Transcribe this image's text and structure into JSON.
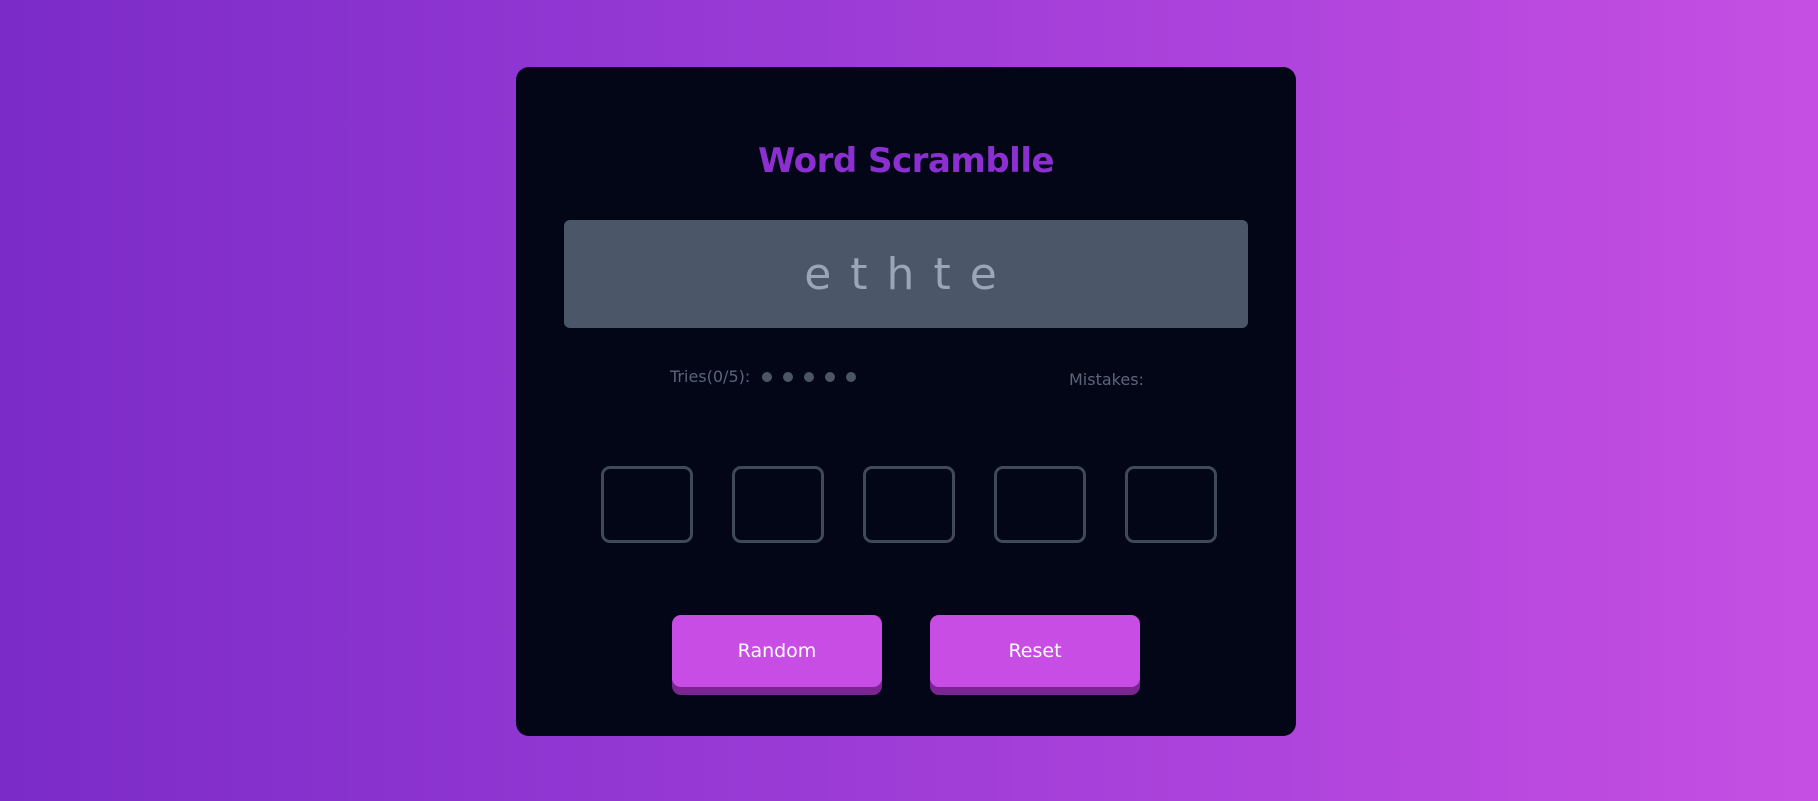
{
  "game": {
    "title": "Word Scramblle",
    "scrambled_word": "ethte",
    "tries_label": "Tries(0/5):",
    "tries_used": 0,
    "tries_max": 5,
    "mistakes_label": "Mistakes:",
    "mistakes_value": "",
    "letter_inputs": [
      "",
      "",
      "",
      "",
      ""
    ]
  },
  "buttons": {
    "random_label": "Random",
    "reset_label": "Reset"
  },
  "colors": {
    "background_gradient_start": "#7b2bc8",
    "background_gradient_end": "#c64fe3",
    "card_background": "#020617",
    "title_color": "#8c2fd1",
    "scramble_background": "#4b5768",
    "button_background": "#c74de4",
    "button_shadow": "#7a2591",
    "dot_color": "#4b5563"
  }
}
